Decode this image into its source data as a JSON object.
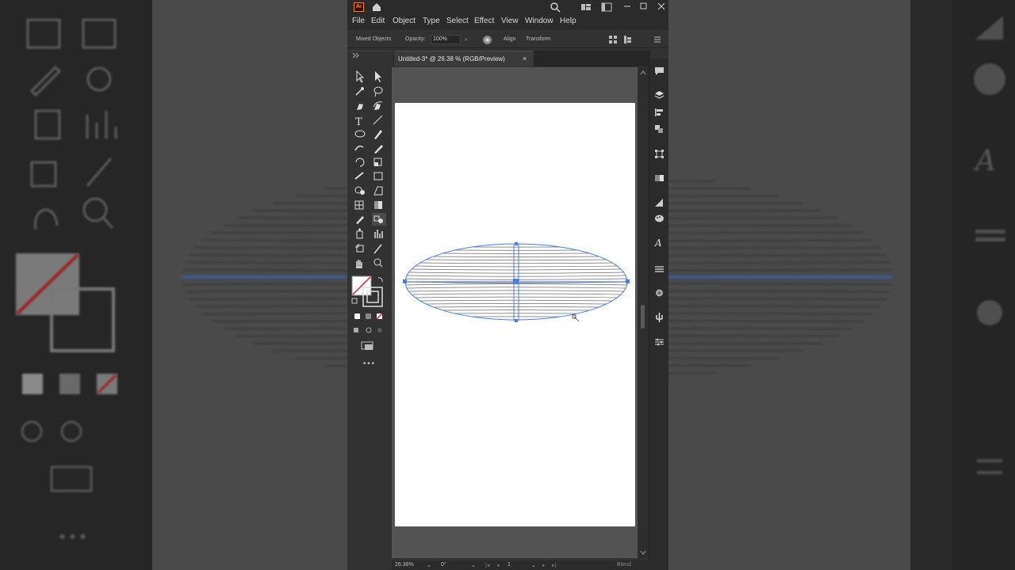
{
  "app": {
    "logo_text": "Ai",
    "document_tab": "Untitled-3* @ 26.38 % (RGB/Preview)",
    "tab_close": "×"
  },
  "menu": [
    "File",
    "Edit",
    "Object",
    "Type",
    "Select",
    "Effect",
    "View",
    "Window",
    "Help"
  ],
  "control_bar": {
    "selection_label": "Mixed Objects",
    "opacity_label": "Opacity:",
    "opacity_value": "100%",
    "align_label": "Align",
    "transform_label": "Transform"
  },
  "status": {
    "zoom": "26.38%",
    "rotation": "0°",
    "artboard_number": "1",
    "tool_name": "Blend"
  },
  "toolbar_more": "•••",
  "colors": {
    "selection_blue": "#4a7fe0",
    "app_bg": "#323232",
    "menubar_bg": "#2b2b2b",
    "artboard": "#ffffff",
    "stroke_gray": "#555555"
  },
  "icons": {
    "title_bar": [
      "home-icon",
      "search-icon",
      "arrange-documents-icon",
      "window-icon",
      "minimize-icon",
      "maximize-icon",
      "close-icon"
    ],
    "tools": [
      "selection-tool-icon",
      "direct-selection-tool-icon",
      "magic-wand-icon",
      "lasso-icon",
      "pen-tool-icon",
      "curvature-tool-icon",
      "type-tool-icon",
      "line-tool-icon",
      "ellipse-tool-icon",
      "paintbrush-icon",
      "shaper-icon",
      "pencil-icon",
      "rotate-icon",
      "scale-icon",
      "puppet-warp-icon",
      "free-transform-icon",
      "shape-builder-icon",
      "perspective-grid-icon",
      "mesh-icon",
      "gradient-icon",
      "eyedropper-icon",
      "blend-tool-icon",
      "symbol-sprayer-icon",
      "column-graph-icon",
      "artboard-tool-icon",
      "slice-icon",
      "hand-tool-icon",
      "zoom-tool-icon"
    ],
    "right_panel": [
      "comments-icon",
      "layers-icon",
      "align-panel-icon",
      "pathfinder-icon",
      "transform-panel-icon",
      "gradient-panel-icon",
      "appearance-icon",
      "color-panel-icon",
      "character-icon",
      "paragraph-icon",
      "stroke-icon",
      "symbols-icon",
      "properties-icon"
    ]
  }
}
